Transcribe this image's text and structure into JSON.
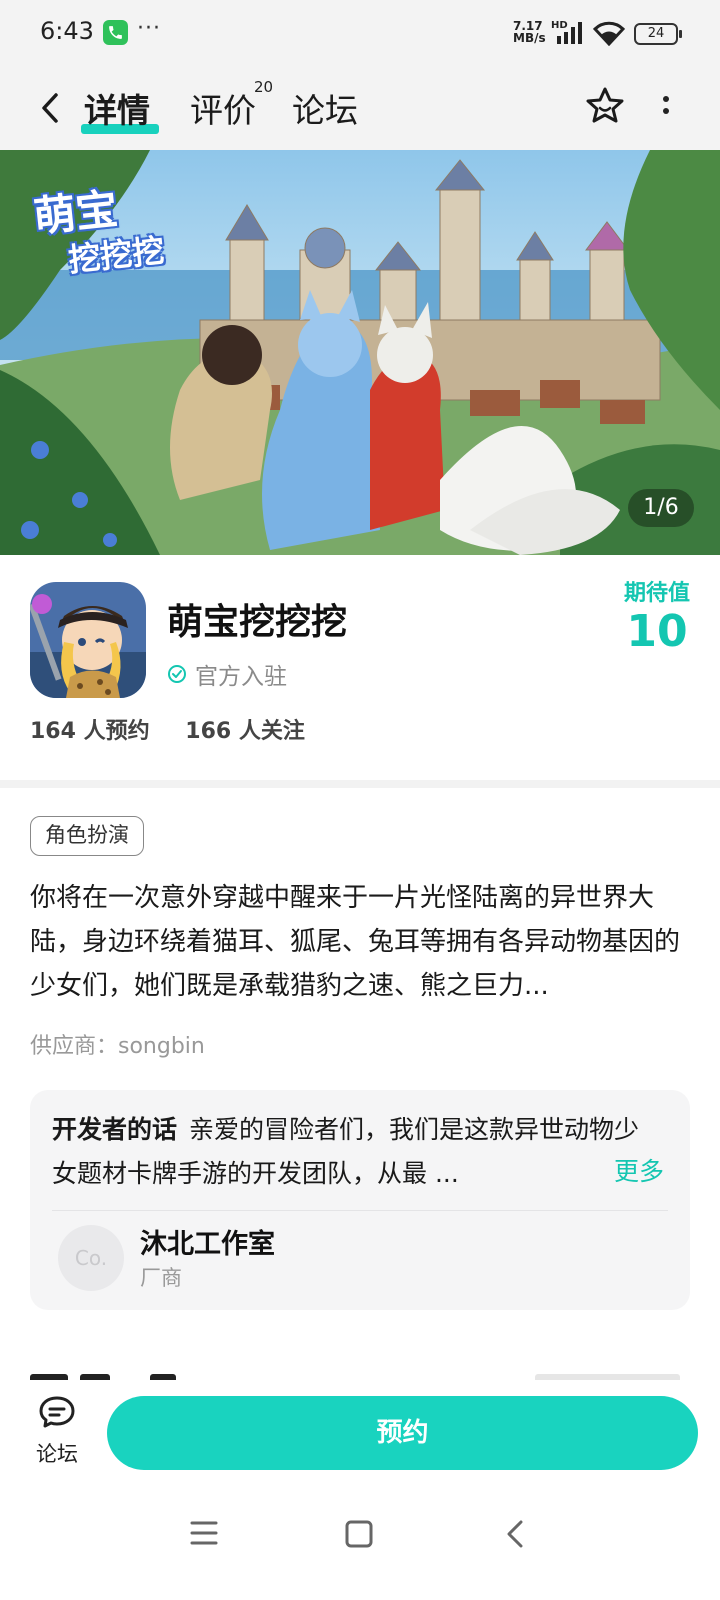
{
  "status_bar": {
    "time": "6:43",
    "dots": "···",
    "net_speed": "7.17 MB/s",
    "hd": "HD",
    "battery": "24"
  },
  "nav": {
    "tabs": [
      {
        "label": "详情"
      },
      {
        "label": "评价",
        "badge": "20"
      },
      {
        "label": "论坛"
      }
    ]
  },
  "banner": {
    "logo_line1": "萌宝",
    "logo_line2": "挖挖挖",
    "counter": "1/6"
  },
  "app": {
    "name": "萌宝挖挖挖",
    "official": "官方入驻",
    "expect_label": "期待值",
    "expect_value": "10",
    "reservations": "164 人预约",
    "followers": "166 人关注"
  },
  "detail": {
    "genre": "角色扮演",
    "description": "你将在一次意外穿越中醒来于一片光怪陆离的异世界大陆，身边环绕着猫耳、狐尾、兔耳等拥有各异动物基因的少女们，她们既是承载猎豹之速、熊之巨力...",
    "supplier": "供应商：songbin"
  },
  "developer": {
    "heading": "开发者的话",
    "text": "亲爱的冒险者们，我们是这款异世动物少女题材卡牌手游的开发团队，从最 ...",
    "more": "更多",
    "avatar_text": "Co.",
    "studio": "沐北工作室",
    "role": "厂商"
  },
  "action_bar": {
    "forum_label": "论坛",
    "reserve_label": "预约"
  },
  "colors": {
    "accent": "#19d3bf",
    "accent_text": "#14c6b1"
  },
  "icons": [
    "back-icon",
    "star-icon",
    "more-icon",
    "verified-icon",
    "forum-icon",
    "menu-icon",
    "home-icon",
    "back-nav-icon"
  ]
}
